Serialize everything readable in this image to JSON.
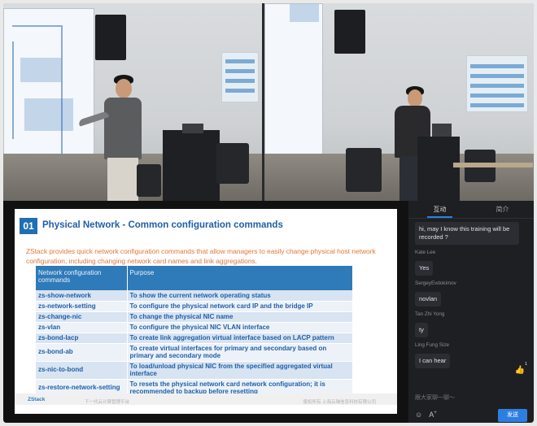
{
  "slide": {
    "number": "01",
    "title": "Physical Network - Common configuration commands",
    "description": "ZStack provides quick network configuration commands that allow managers to easily change physical host network configuration, including changing network card names and link aggregations.",
    "table": {
      "headers": [
        "Network configuration commands",
        "Purpose"
      ],
      "rows": [
        {
          "cmd": "zs-show-network",
          "purpose": "To show the current network operating status"
        },
        {
          "cmd": "zs-network-setting",
          "purpose": "To configure the physical network card IP and the bridge IP"
        },
        {
          "cmd": "zs-change-nic",
          "purpose": "To change the physical NIC name"
        },
        {
          "cmd": "zs-vlan",
          "purpose": "To configure the physical NIC VLAN interface"
        },
        {
          "cmd": "zs-bond-lacp",
          "purpose": "To create link aggregation virtual interface based on LACP pattern"
        },
        {
          "cmd": "zs-bond-ab",
          "purpose": "To create virtual interfaces for primary and secondary based on primary and secondary mode"
        },
        {
          "cmd": "zs-nic-to-bond",
          "purpose": "To load/unload physical NIC from the specified aggregated virtual interface"
        },
        {
          "cmd": "zs-restore-network-setting",
          "purpose": "To resets the physical network card network configuration; it is recommended to backup before resetting"
        }
      ]
    },
    "footer_logo": "ZStack",
    "footer_left": "下一代云计算管理平台",
    "footer_right": "版权所有 上海云轴信息科技有限公司"
  },
  "chat": {
    "tabs": [
      "互动",
      "简介"
    ],
    "messages": [
      {
        "name": "",
        "text": "hi, may I know this training will be recorded ?"
      },
      {
        "name": "Kate Lee",
        "text": "Yes"
      },
      {
        "name": "SergeyEvdokimov",
        "text": "novlan"
      },
      {
        "name": "Tan Zhi Yong",
        "text": "ty"
      },
      {
        "name": "Ling Fung Size",
        "text": "I can hear"
      }
    ],
    "like_count": "1",
    "input_placeholder": "跟大家聊一聊～",
    "send_label": "发送",
    "icons": [
      "emoji-icon",
      "font-icon",
      "thumbs-up-icon"
    ]
  },
  "colors": {
    "accent": "#2b7fe0",
    "slide_title": "#1f5fa8",
    "slide_desc": "#e0773a",
    "table_header": "#2f7ab8"
  }
}
